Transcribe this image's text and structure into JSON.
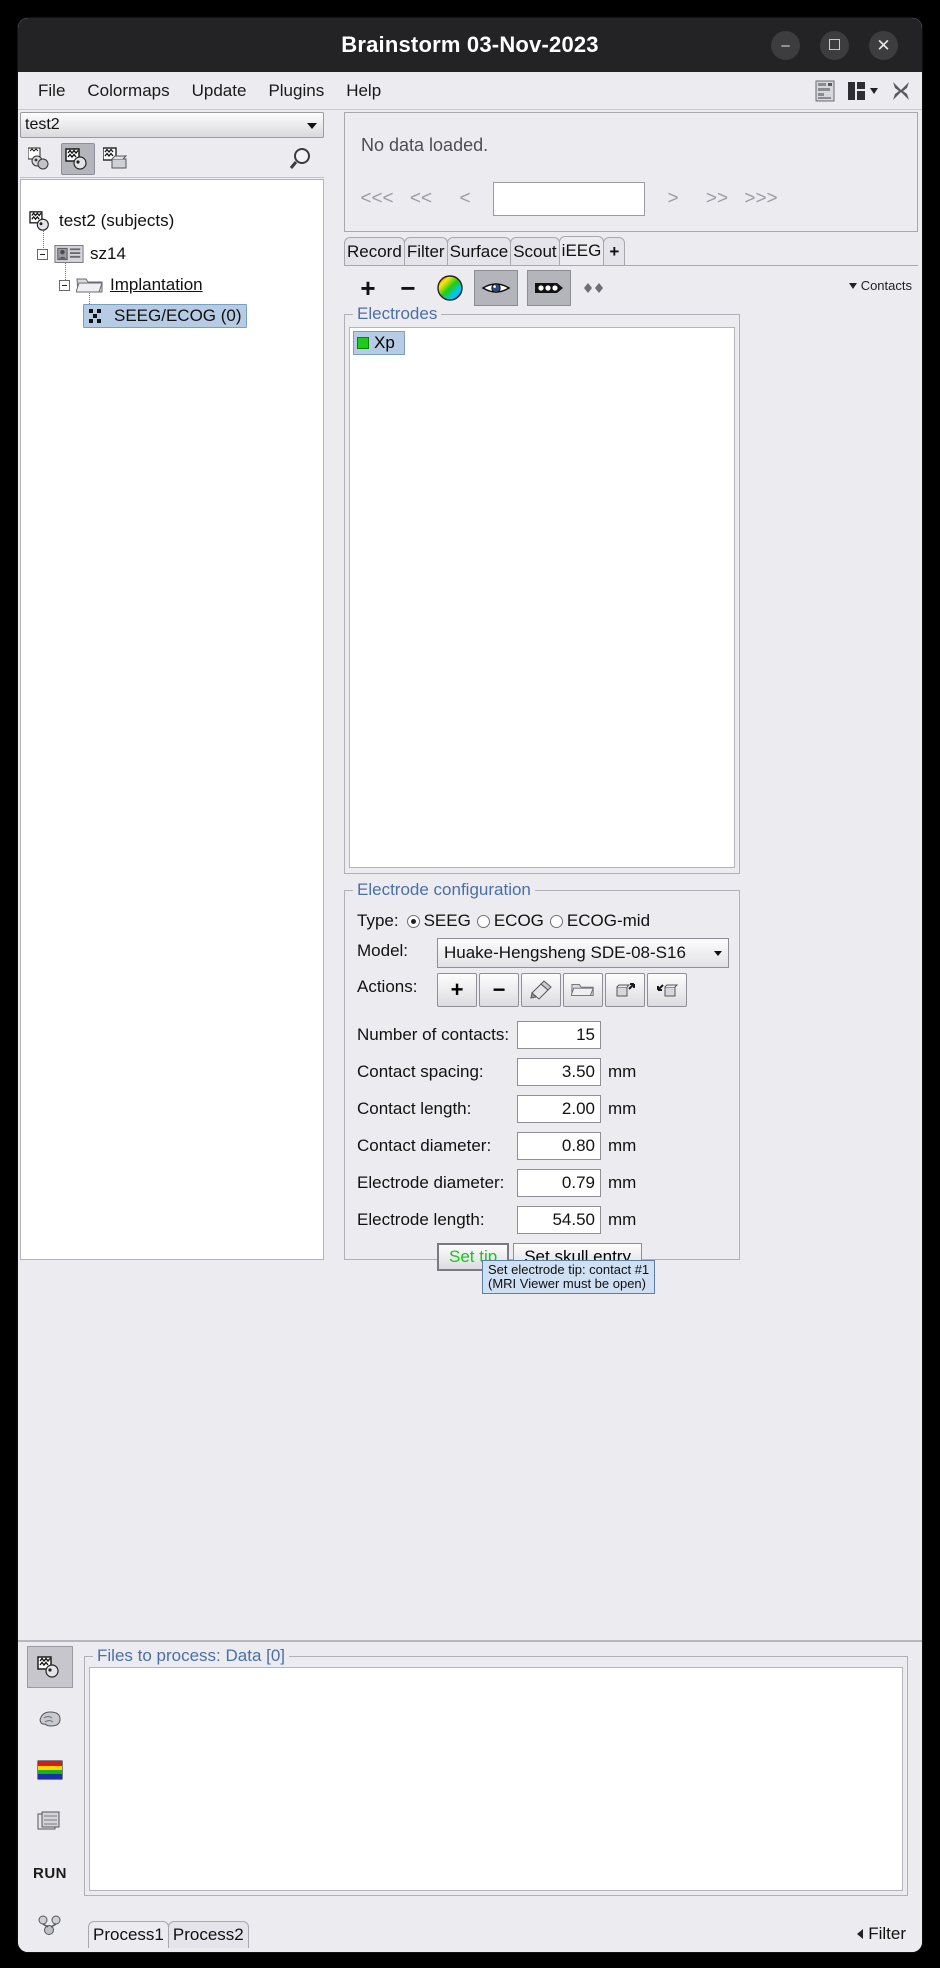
{
  "window": {
    "title": "Brainstorm 03-Nov-2023",
    "minimize": "–",
    "maximize": "☐",
    "close": "✕"
  },
  "menubar": {
    "items": [
      {
        "label": "File"
      },
      {
        "label": "Colormaps"
      },
      {
        "label": "Update"
      },
      {
        "label": "Plugins"
      },
      {
        "label": "Help"
      }
    ],
    "tools": [
      {
        "name": "layout-list-icon"
      },
      {
        "name": "layout-grid-icon"
      },
      {
        "name": "close-all-figures-icon"
      }
    ]
  },
  "left_panel": {
    "protocol_combo": {
      "value": "test2"
    },
    "toolbar": [
      {
        "name": "subjects-anatomy-icon"
      },
      {
        "name": "functional-data-subjects-icon"
      },
      {
        "name": "functional-data-conditions-icon"
      },
      {
        "name": "search-icon"
      }
    ],
    "tree": [
      {
        "label": "test2 (subjects)",
        "icon": "protocol-icon",
        "depth": 0,
        "selected": false,
        "link": false
      },
      {
        "label": "sz14",
        "icon": "subject-icon",
        "depth": 1,
        "selected": false,
        "link": false
      },
      {
        "label": "Implantation",
        "icon": "folder-icon",
        "depth": 2,
        "selected": false,
        "link": true
      },
      {
        "label": "SEEG/ECOG (0)",
        "icon": "seeg-ecog-icon",
        "depth": 3,
        "selected": true,
        "link": false
      }
    ]
  },
  "right_panel": {
    "status": "No data loaded.",
    "nav": {
      "buttons": [
        "<<<",
        "<<",
        "<",
        ">",
        ">>",
        ">>>"
      ],
      "field_value": ""
    },
    "tabs": [
      {
        "label": "Record",
        "active": false
      },
      {
        "label": "Filter",
        "active": false
      },
      {
        "label": "Surface",
        "active": false
      },
      {
        "label": "Scout",
        "active": false
      },
      {
        "label": "iEEG",
        "active": true
      },
      {
        "label": "+",
        "active": false
      }
    ],
    "ieeg_toolbar": {
      "add": {
        "name": "add-electrode-icon",
        "glyph": "+"
      },
      "remove": {
        "name": "remove-electrode-icon",
        "glyph": "−"
      },
      "color": {
        "name": "color-wheel-icon"
      },
      "show_hide": {
        "name": "eye-visibility-icon",
        "pressed": true
      },
      "contacts_display": {
        "name": "contacts-display-icon",
        "pressed": true
      },
      "pair_contacts": {
        "name": "pair-contacts-icon"
      },
      "contacts_menu": {
        "label": "Contacts"
      }
    },
    "electrodes_group": {
      "title": "Electrodes",
      "items": [
        {
          "label": "Xp",
          "color": "#1ecc1e",
          "selected": true
        }
      ]
    },
    "config_group": {
      "title": "Electrode configuration",
      "type_label": "Type:",
      "type_options": [
        {
          "label": "SEEG",
          "selected": true
        },
        {
          "label": "ECOG",
          "selected": false
        },
        {
          "label": "ECOG-mid",
          "selected": false
        }
      ],
      "model_label": "Model:",
      "model_value": "Huake-Hengsheng SDE-08-S16",
      "actions_label": "Actions:",
      "actions": [
        {
          "name": "add-model-icon",
          "glyph": "+"
        },
        {
          "name": "remove-model-icon",
          "glyph": "−"
        },
        {
          "name": "edit-model-icon"
        },
        {
          "name": "load-model-icon"
        },
        {
          "name": "export-model-icon"
        },
        {
          "name": "import-model-icon"
        }
      ],
      "fields": [
        {
          "label": "Number of contacts:",
          "value": "15",
          "unit": ""
        },
        {
          "label": "Contact spacing:",
          "value": "3.50",
          "unit": "mm"
        },
        {
          "label": "Contact length:",
          "value": "2.00",
          "unit": "mm"
        },
        {
          "label": "Contact diameter:",
          "value": "0.80",
          "unit": "mm"
        },
        {
          "label": "Electrode diameter:",
          "value": "0.79",
          "unit": "mm"
        },
        {
          "label": "Electrode length:",
          "value": "54.50",
          "unit": "mm"
        }
      ],
      "set_tip_button": "Set tip",
      "set_skull_entry_button": "Set skull entry",
      "tooltip": "Set electrode tip: contact #1\n(MRI Viewer must be open)"
    }
  },
  "bottom_panel": {
    "toolbar": [
      {
        "name": "process-data-icon",
        "selected": true
      },
      {
        "name": "process-sources-icon",
        "selected": false
      },
      {
        "name": "process-timefreq-icon",
        "selected": false
      },
      {
        "name": "process-matrix-icon",
        "selected": false
      },
      {
        "name": "run-button",
        "label": "RUN",
        "selected": false
      },
      {
        "name": "pipeline-icon",
        "selected": false
      }
    ],
    "files_title": "Files to process: Data [0]",
    "tabs": [
      {
        "label": "Process1",
        "active": true
      },
      {
        "label": "Process2",
        "active": false
      }
    ],
    "filter_label": "Filter"
  },
  "colors": {
    "accent_blue": "#4a6fa8",
    "selection_blue": "#b6cbe4",
    "green_text": "#17c617",
    "window_bg": "#ececf0",
    "titlebar_bg": "#232326"
  }
}
